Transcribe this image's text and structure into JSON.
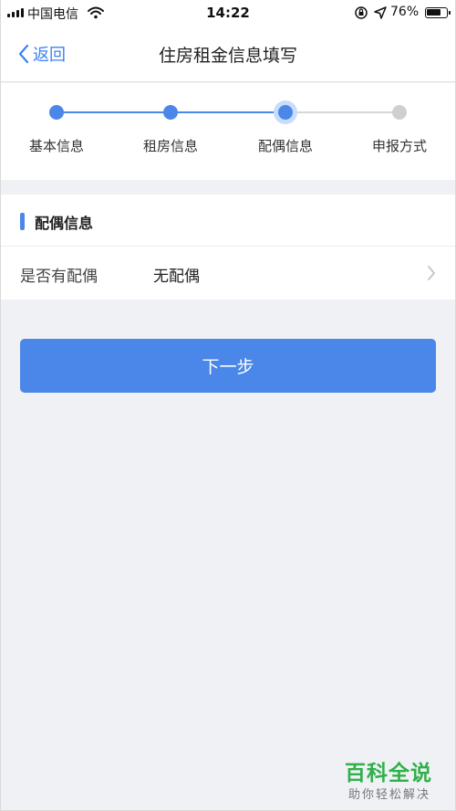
{
  "status_bar": {
    "carrier": "中国电信",
    "time": "14:22",
    "battery_percent": "76%",
    "battery_level": 0.76
  },
  "nav": {
    "back_label": "返回",
    "title": "住房租金信息填写"
  },
  "stepper": {
    "steps": [
      {
        "label": "基本信息",
        "state": "done"
      },
      {
        "label": "租房信息",
        "state": "done"
      },
      {
        "label": "配偶信息",
        "state": "current"
      },
      {
        "label": "申报方式",
        "state": "pending"
      }
    ]
  },
  "section": {
    "title": "配偶信息",
    "row_label": "是否有配偶",
    "row_value": "无配偶"
  },
  "next_button": {
    "label": "下一步"
  },
  "watermark": {
    "title": "百科全说",
    "subtitle": "助你轻松解决"
  },
  "colors": {
    "accent": "#4a87e8",
    "background": "#f0f1f5",
    "watermark_green": "#2fb04a"
  },
  "icons": [
    "signal-icon",
    "wifi-icon",
    "rotation-lock-icon",
    "location-icon",
    "battery-icon",
    "back-chevron-icon",
    "chevron-right-icon"
  ]
}
